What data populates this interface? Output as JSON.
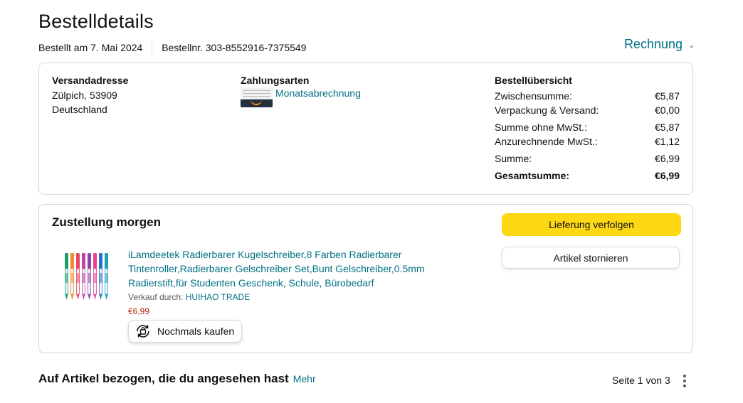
{
  "header": {
    "title": "Bestelldetails",
    "ordered_on": "Bestellt am 7. Mai 2024",
    "order_number": "Bestellnr. 303-8552916-7375549",
    "invoice_label": "Rechnung"
  },
  "details": {
    "shipping": {
      "heading": "Versandadresse",
      "line1": "Zülpich, 53909",
      "line2": "Deutschland"
    },
    "payment": {
      "heading": "Zahlungsarten",
      "method": "Monatsabrechnung"
    },
    "summary": {
      "heading": "Bestellübersicht",
      "rows": [
        {
          "label": "Zwischensumme:",
          "value": "€5,87"
        },
        {
          "label": "Verpackung & Versand:",
          "value": "€0,00"
        },
        {
          "label": "Summe ohne MwSt.:",
          "value": "€5,87"
        },
        {
          "label": "Anzurechnende MwSt.:",
          "value": "€1,12"
        },
        {
          "label": "Summe:",
          "value": "€6,99"
        },
        {
          "label": "Gesamtsumme:",
          "value": "€6,99"
        }
      ]
    }
  },
  "delivery": {
    "status": "Zustellung morgen",
    "track_button": "Lieferung verfolgen",
    "cancel_button": "Artikel stornieren",
    "product": {
      "title": "iLamdeetek Radierbarer Kugelschreiber,8 Farben Radierbarer Tintenroller,Radierbarer Gelschreiber Set,Bunt Gelschreiber,0.5mm Radierstift,für Studenten Geschenk, Schule, Bürobedarf",
      "sold_by_label": "Verkauf durch:",
      "seller": "HUIHAO TRADE",
      "price": "€6,99",
      "buy_again": "Nochmals kaufen",
      "pen_colors": [
        "#1a9e6a",
        "#f08a2c",
        "#e8475f",
        "#c2459c",
        "#8e44ad",
        "#e84393",
        "#2c6fd1",
        "#17a2b8"
      ]
    }
  },
  "recommendations": {
    "heading": "Auf Artikel bezogen, die du angesehen hast",
    "more": "Mehr",
    "pager": "Seite 1 von 3"
  }
}
